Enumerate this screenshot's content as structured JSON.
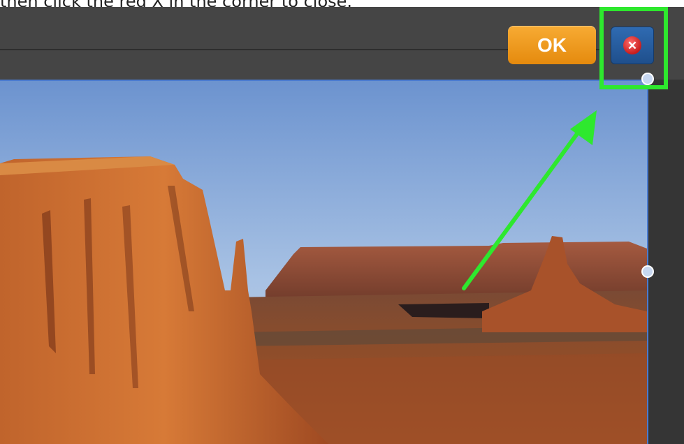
{
  "caption": {
    "text": "then click the red X in the corner to close."
  },
  "toolbar": {
    "ok_label": "OK",
    "close_symbol": "✕",
    "ok_color": "#f09a1f",
    "close_color": "#2a5fa3"
  },
  "annotation": {
    "highlight_color": "#2ee82e",
    "arrow_color": "#2ee82e"
  },
  "canvas": {
    "image_subject": "desert-mesa-landscape",
    "accent_border_color": "#4a7bd0"
  }
}
